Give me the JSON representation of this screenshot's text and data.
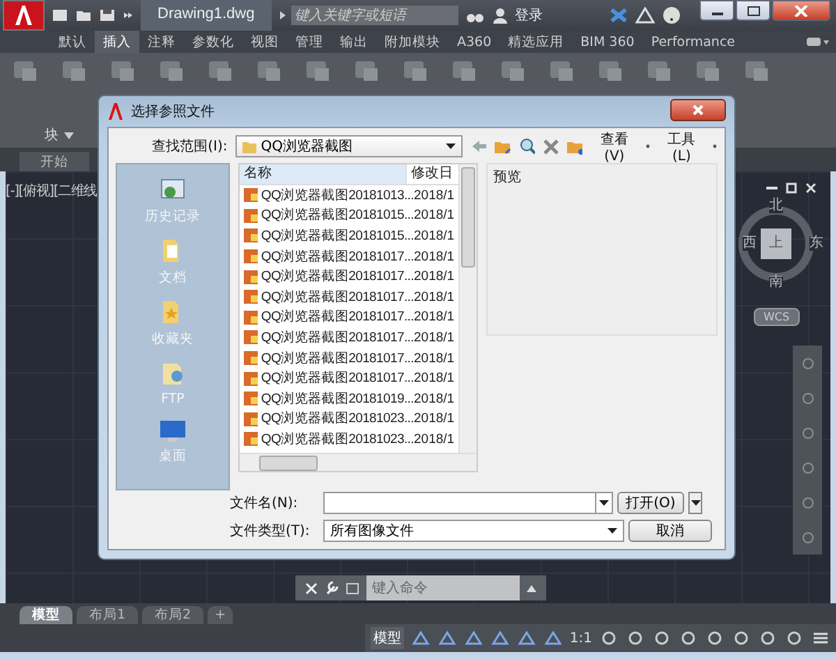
{
  "window": {
    "title": "Drawing1.dwg",
    "search_placeholder": "键入关键字或短语",
    "user": "登录"
  },
  "ribbon": {
    "tabs": [
      {
        "label": "默认",
        "selected": false
      },
      {
        "label": "插入",
        "selected": true
      },
      {
        "label": "注释",
        "selected": false
      },
      {
        "label": "参数化",
        "selected": false
      },
      {
        "label": "视图",
        "selected": false
      },
      {
        "label": "管理",
        "selected": false
      },
      {
        "label": "输出",
        "selected": false
      },
      {
        "label": "附加模块",
        "selected": false
      },
      {
        "label": "A360",
        "selected": false
      },
      {
        "label": "精选应用",
        "selected": false
      },
      {
        "label": "BIM 360",
        "selected": false
      },
      {
        "label": "Performance",
        "selected": false
      }
    ],
    "panel_label": "块"
  },
  "start_tab": "开始",
  "viewport": {
    "label": "[-][俯视][二维线",
    "compass": {
      "north": "北",
      "west": "西",
      "face": "上",
      "east": "东",
      "south": "南"
    },
    "ucs": "WCS"
  },
  "dialog": {
    "title": "选择参照文件",
    "look_in_label": "查找范围(I):",
    "look_in": "QQ浏览器截图",
    "view_menu": "查看(V)",
    "tools_menu": "工具(L)",
    "places": [
      {
        "kind": "history",
        "label": "历史记录"
      },
      {
        "kind": "documents",
        "label": "文档"
      },
      {
        "kind": "favorites",
        "label": "收藏夹"
      },
      {
        "kind": "ftp",
        "label": "FTP"
      },
      {
        "kind": "desktop",
        "label": "桌面"
      }
    ],
    "columns": [
      "名称",
      "修改日"
    ],
    "files": [
      {
        "name": "QQ浏览器截图20181013...",
        "date": "2018/1"
      },
      {
        "name": "QQ浏览器截图20181015...",
        "date": "2018/1"
      },
      {
        "name": "QQ浏览器截图20181015...",
        "date": "2018/1"
      },
      {
        "name": "QQ浏览器截图20181017...",
        "date": "2018/1"
      },
      {
        "name": "QQ浏览器截图20181017...",
        "date": "2018/1"
      },
      {
        "name": "QQ浏览器截图20181017...",
        "date": "2018/1"
      },
      {
        "name": "QQ浏览器截图20181017...",
        "date": "2018/1"
      },
      {
        "name": "QQ浏览器截图20181017...",
        "date": "2018/1"
      },
      {
        "name": "QQ浏览器截图20181017...",
        "date": "2018/1"
      },
      {
        "name": "QQ浏览器截图20181017...",
        "date": "2018/1"
      },
      {
        "name": "QQ浏览器截图20181019...",
        "date": "2018/1"
      },
      {
        "name": "QQ浏览器截图20181023...",
        "date": "2018/1"
      },
      {
        "name": "QQ浏览器截图20181023...",
        "date": "2018/1"
      }
    ],
    "preview_label": "预览",
    "file_name_label": "文件名(N):",
    "file_type_label": "文件类型(T):",
    "file_type": "所有图像文件",
    "open_button": "打开(O)",
    "cancel_button": "取消"
  },
  "command_line": {
    "placeholder": "键入命令"
  },
  "layout_tabs": [
    {
      "label": "模型",
      "selected": true
    },
    {
      "label": "布局1",
      "selected": false
    },
    {
      "label": "布局2",
      "selected": false
    }
  ],
  "add_tab": "+",
  "status_bar": {
    "model": "模型",
    "scale": "1:1"
  }
}
